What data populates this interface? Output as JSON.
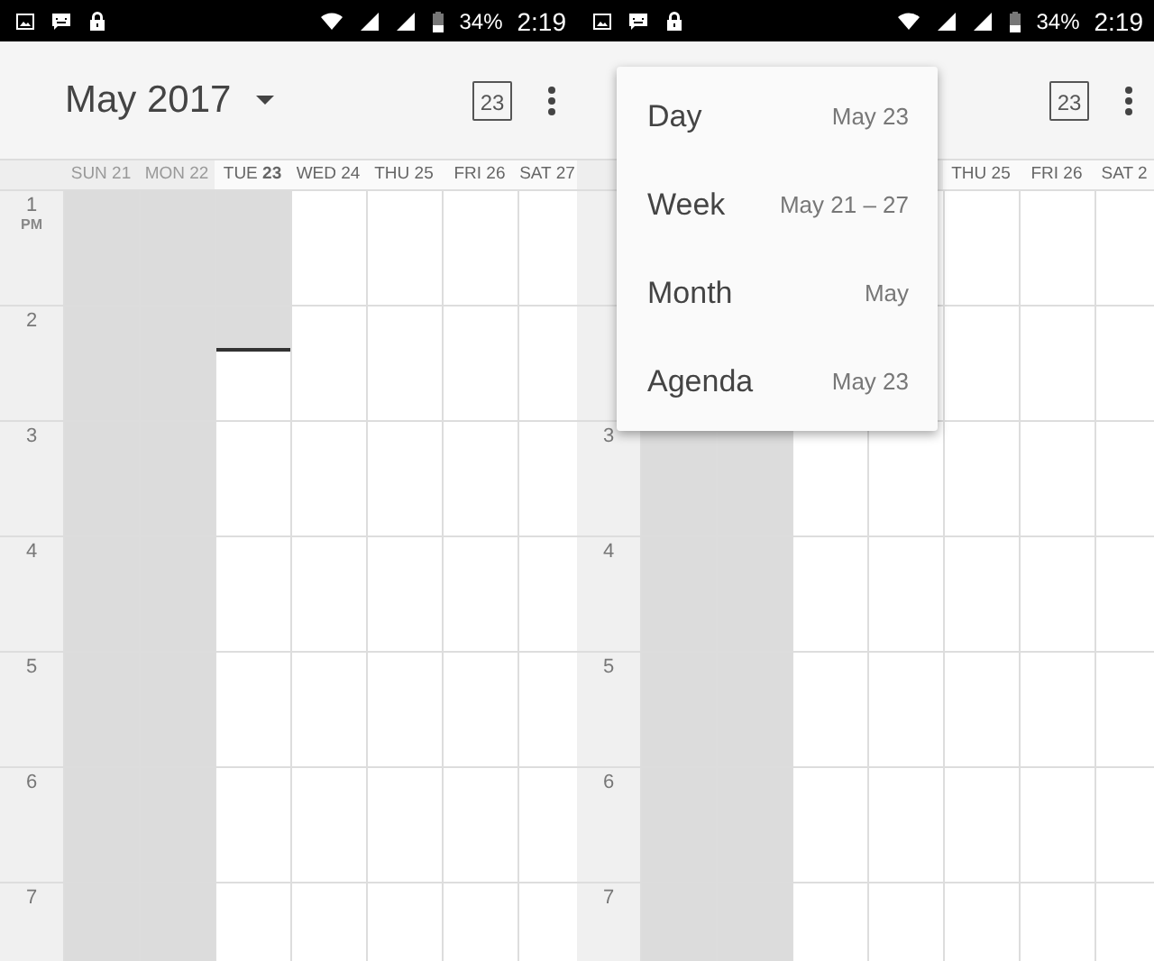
{
  "screens": [
    {
      "status_bar": {
        "battery": "34%",
        "time": "2:19"
      },
      "toolbar": {
        "title": "May 2017",
        "today_badge": "23"
      },
      "days": [
        {
          "label": "SUN 21",
          "past": true,
          "today": false
        },
        {
          "label": "MON 22",
          "past": true,
          "today": false
        },
        {
          "label": "TUE **23**",
          "past": false,
          "today": true,
          "level": 0.196
        },
        {
          "label": "WED 24",
          "past": false,
          "today": false
        },
        {
          "label": "THU 25",
          "past": false,
          "today": false
        },
        {
          "label": "FRI 26",
          "past": false,
          "today": false
        },
        {
          "label": "SAT 27",
          "past": false,
          "today": false
        }
      ],
      "hours": [
        {
          "label": "1",
          "suffix": "PM"
        },
        {
          "label": "2"
        },
        {
          "label": "3"
        },
        {
          "label": "4"
        },
        {
          "label": "5"
        },
        {
          "label": "6"
        },
        {
          "label": "7"
        }
      ]
    },
    {
      "status_bar": {
        "battery": "34%",
        "time": "2:19"
      },
      "toolbar": {
        "today_badge": "23"
      },
      "days": [
        {
          "past": true
        },
        {
          "past": true
        },
        {
          "past": false
        },
        {
          "past": false
        },
        {
          "label": "THU 25",
          "past": false
        },
        {
          "label": "FRI 26",
          "past": false
        },
        {
          "label": "SAT 2",
          "past": false
        }
      ],
      "hours": [
        {
          "label": "3"
        },
        {
          "label": "4"
        },
        {
          "label": "5"
        },
        {
          "label": "6"
        },
        {
          "label": "7"
        }
      ],
      "menu": [
        {
          "label": "Day",
          "date": "May 23"
        },
        {
          "label": "Week",
          "date": "May 21 – 27"
        },
        {
          "label": "Month",
          "date": "May"
        },
        {
          "label": "Agenda",
          "date": "May 23"
        }
      ]
    }
  ]
}
